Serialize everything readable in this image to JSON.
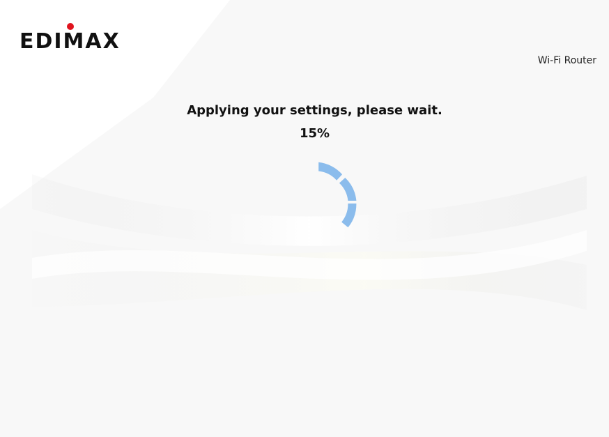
{
  "header": {
    "logo_text": "EDIMAX",
    "product_label": "Wi-Fi Router"
  },
  "status": {
    "message": "Applying your settings, please wait.",
    "progress_label": "15%",
    "progress_fraction": 0.15
  },
  "icons": {
    "loading": "loading-spinner-icon"
  },
  "colors": {
    "spinner": "#8bbcec",
    "logo_dot": "#e0141e",
    "logo_text": "#111111"
  }
}
